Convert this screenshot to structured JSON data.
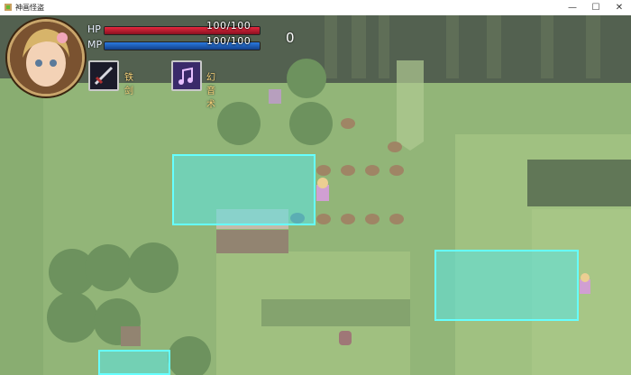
{
  "window": {
    "title": "神画怪盗",
    "minimize_icon": "minimize-icon",
    "maximize_icon": "maximize-icon",
    "close_icon": "close-icon"
  },
  "hud": {
    "hp_label": "HP",
    "hp_value": "100/100",
    "hp_fraction": 1.0,
    "mp_label": "MP",
    "mp_value": "100/100",
    "mp_fraction": 1.0,
    "score": "0",
    "weapon": {
      "icon": "sword-icon",
      "label": "铁剑"
    },
    "skill": {
      "icon": "music-note-icon",
      "label": "幻音术"
    }
  },
  "colors": {
    "hp": "#e5283e",
    "mp": "#2a7ae0",
    "highlight": "#5ae6e6",
    "grass": "#79a35b",
    "forest": "#2f4a2a"
  }
}
